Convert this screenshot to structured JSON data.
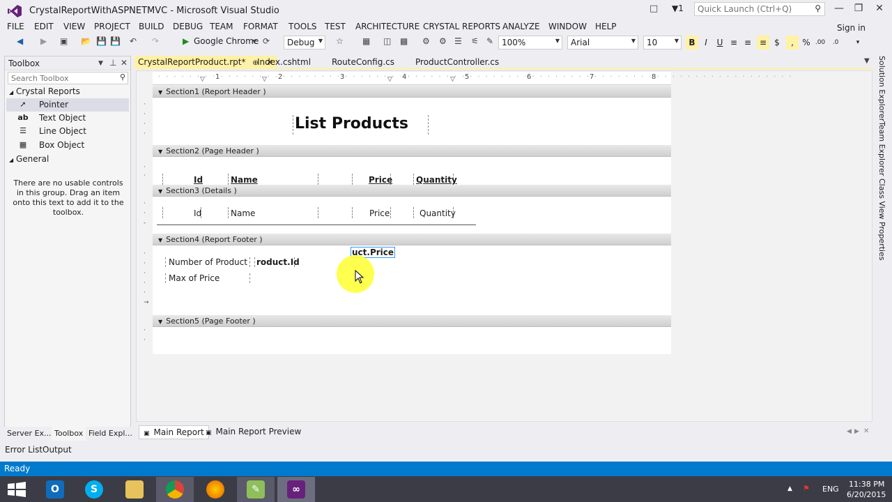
{
  "window": {
    "title": "CrystalReportWithASPNETMVC - Microsoft Visual Studio",
    "quick_launch_placeholder": "Quick Launch (Ctrl+Q)",
    "notification_count": "1",
    "sign_in": "Sign in"
  },
  "menu": [
    "FILE",
    "EDIT",
    "VIEW",
    "PROJECT",
    "BUILD",
    "DEBUG",
    "TEAM",
    "FORMAT",
    "TOOLS",
    "TEST",
    "ARCHITECTURE",
    "CRYSTAL REPORTS",
    "ANALYZE",
    "WINDOW",
    "HELP"
  ],
  "toolbar": {
    "browser": "Google Chrome",
    "configuration": "Debug",
    "zoom": "100%",
    "font": "Arial",
    "font_size": "10"
  },
  "toolbox": {
    "title": "Toolbox",
    "search_placeholder": "Search Toolbox",
    "groups": [
      {
        "label": "Crystal Reports",
        "items": [
          {
            "label": "Pointer",
            "icon": "pointer-icon"
          },
          {
            "label": "Text Object",
            "icon": "text-object-icon"
          },
          {
            "label": "Line Object",
            "icon": "line-object-icon"
          },
          {
            "label": "Box Object",
            "icon": "box-object-icon"
          }
        ]
      },
      {
        "label": "General",
        "items": []
      }
    ],
    "empty_message": "There are no usable controls in this group. Drag an item onto this text to add it to the toolbox.",
    "tabs": [
      "Server Ex...",
      "Toolbox",
      "Field Expl..."
    ]
  },
  "document_tabs": [
    {
      "label": "CrystalReportProduct.rpt*",
      "active": true
    },
    {
      "label": "Index.cshtml",
      "active": false
    },
    {
      "label": "RouteConfig.cs",
      "active": false
    },
    {
      "label": "ProductController.cs",
      "active": false
    }
  ],
  "ruler": [
    "1",
    "2",
    "3",
    "4",
    "5",
    "6",
    "7",
    "8"
  ],
  "report": {
    "sections": [
      "Section1 (Report Header )",
      "Section2 (Page Header )",
      "Section3 (Details )",
      "Section4 (Report Footer )",
      "Section5 (Page Footer )"
    ],
    "title": "List Products",
    "page_header": {
      "id": "Id",
      "name": "Name",
      "price": "Price",
      "quantity": "Quantity"
    },
    "details": {
      "id": "Id",
      "name": "Name",
      "price": "Price",
      "quantity": "Quantity"
    },
    "footer": {
      "selected_field": "uct.Price",
      "number_label": "Number of Product",
      "number_value": "roduct.Id",
      "max_label": "Max of Price"
    }
  },
  "editor_tabs": [
    "Main Report",
    "Main Report Preview"
  ],
  "right_tabs": [
    "Solution Explorer",
    "Team Explorer",
    "Class View",
    "Properties"
  ],
  "bottom_tabs": [
    "Error List",
    "Output"
  ],
  "status": "Ready",
  "tray": {
    "language": "ENG",
    "time": "11:38 PM",
    "date": "6/20/2015"
  },
  "colors": {
    "status_bar": "#007acc",
    "active_tab": "#fff1a5",
    "vs_purple": "#68217a",
    "cursor_highlight": "#ffff3c"
  }
}
